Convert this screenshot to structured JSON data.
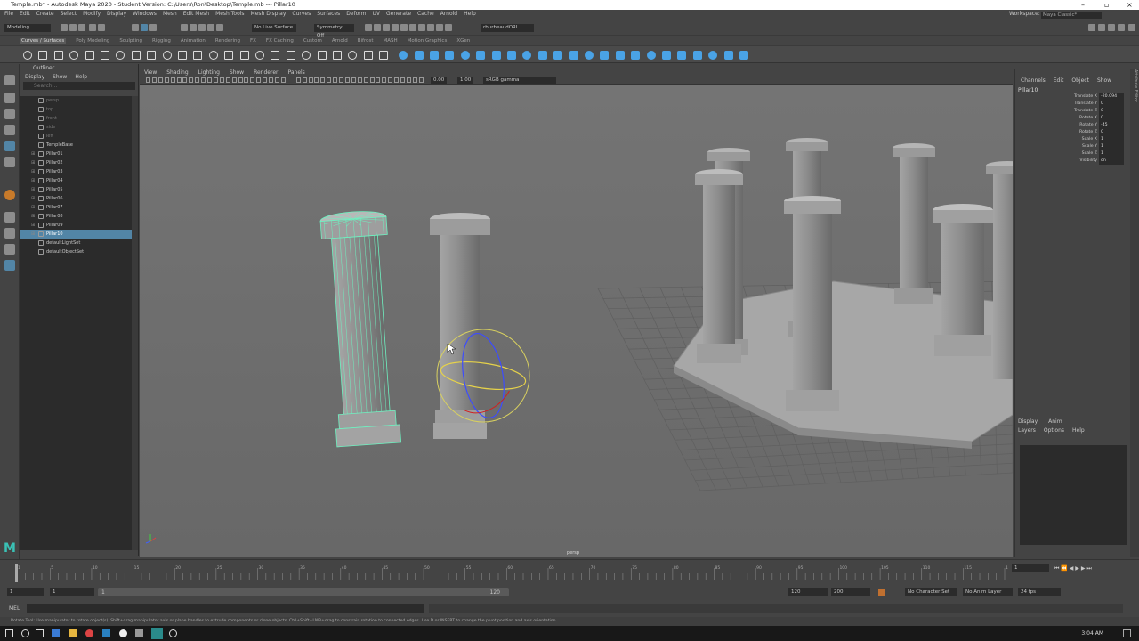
{
  "title_bar": {
    "title": "Temple.mb* - Autodesk Maya 2020 - Student Version: C:\\Users\\Ron\\Desktop\\Temple.mb --- Pillar10"
  },
  "menu_bar": {
    "items": [
      "File",
      "Edit",
      "Create",
      "Select",
      "Modify",
      "Display",
      "Windows",
      "Mesh",
      "Edit Mesh",
      "Mesh Tools",
      "Mesh Display",
      "Curves",
      "Surfaces",
      "Deform",
      "UV",
      "Generate",
      "Cache",
      "Arnold",
      "Help"
    ]
  },
  "workspace": {
    "label": "Workspace:",
    "value": "Maya Classic*"
  },
  "status_line": {
    "mode": "Modeling",
    "live_surface": "No Live Surface",
    "symmetry": "Symmetry: Off",
    "user": "rburbeaudORL"
  },
  "shelf_tabs": [
    "Curves / Surfaces",
    "Poly Modeling",
    "Sculpting",
    "Rigging",
    "Animation",
    "Rendering",
    "FX",
    "FX Caching",
    "Custom",
    "Arnold",
    "Bifrost",
    "MASH",
    "Motion Graphics",
    "XGen"
  ],
  "shelf_tabs_active": 0,
  "outliner": {
    "title": "Outliner",
    "menu": [
      "Display",
      "Show",
      "Help"
    ],
    "search_placeholder": "Search...",
    "items": [
      {
        "label": "persp",
        "dim": true,
        "expandable": false
      },
      {
        "label": "top",
        "dim": true,
        "expandable": false
      },
      {
        "label": "front",
        "dim": true,
        "expandable": false
      },
      {
        "label": "side",
        "dim": true,
        "expandable": false
      },
      {
        "label": "left",
        "dim": true,
        "expandable": false
      },
      {
        "label": "TempleBase",
        "dim": false,
        "expandable": false
      },
      {
        "label": "Pillar01",
        "dim": false,
        "expandable": true
      },
      {
        "label": "Pillar02",
        "dim": false,
        "expandable": true
      },
      {
        "label": "Pillar03",
        "dim": false,
        "expandable": true
      },
      {
        "label": "Pillar04",
        "dim": false,
        "expandable": true
      },
      {
        "label": "Pillar05",
        "dim": false,
        "expandable": true
      },
      {
        "label": "Pillar06",
        "dim": false,
        "expandable": true
      },
      {
        "label": "Pillar07",
        "dim": false,
        "expandable": true
      },
      {
        "label": "Pillar08",
        "dim": false,
        "expandable": true
      },
      {
        "label": "Pillar09",
        "dim": false,
        "expandable": true
      },
      {
        "label": "Pillar10",
        "dim": false,
        "expandable": true,
        "selected": true
      },
      {
        "label": "defaultLightSet",
        "dim": false,
        "expandable": false
      },
      {
        "label": "defaultObjectSet",
        "dim": false,
        "expandable": false
      }
    ]
  },
  "viewport": {
    "menu": [
      "View",
      "Shading",
      "Lighting",
      "Show",
      "Renderer",
      "Panels"
    ],
    "exposure": "0.00",
    "gamma": "1.00",
    "color_space": "sRGB gamma",
    "camera_label": "persp"
  },
  "channel_box": {
    "menu": [
      "Channels",
      "Edit",
      "Object",
      "Show"
    ],
    "object": "Pillar10",
    "channels": [
      {
        "name": "Translate X",
        "value": "-20.094"
      },
      {
        "name": "Translate Y",
        "value": "0"
      },
      {
        "name": "Translate Z",
        "value": "0"
      },
      {
        "name": "Rotate X",
        "value": "0"
      },
      {
        "name": "Rotate Y",
        "value": "-45"
      },
      {
        "name": "Rotate Z",
        "value": "0"
      },
      {
        "name": "Scale X",
        "value": "1"
      },
      {
        "name": "Scale Y",
        "value": "1"
      },
      {
        "name": "Scale Z",
        "value": "1"
      },
      {
        "name": "Visibility",
        "value": "on"
      }
    ],
    "layer_tabs": [
      "Display",
      "Anim"
    ],
    "layer_menu": [
      "Layers",
      "Options",
      "Help"
    ]
  },
  "side_tabs": [
    "Channel Box / Layer Editor",
    "Modeling Toolkit",
    "Attribute Editor"
  ],
  "time_slider": {
    "ticks": [
      "1",
      "",
      "",
      "",
      "5",
      "",
      "",
      "",
      "",
      "10",
      "",
      "",
      "",
      "",
      "15",
      "",
      "",
      "",
      "",
      "20",
      "",
      "",
      "",
      "",
      "25",
      "",
      "",
      "",
      "",
      "30",
      "",
      "",
      "",
      "",
      "35",
      "",
      "",
      "",
      "",
      "40",
      "",
      "",
      "",
      "",
      "45",
      "",
      "",
      "",
      "",
      "50",
      "",
      "",
      "",
      "",
      "55",
      "",
      "",
      "",
      "",
      "60",
      "",
      "",
      "",
      "",
      "65",
      "",
      "",
      "",
      "",
      "70",
      "",
      "",
      "",
      "",
      "75",
      "",
      "",
      "",
      "",
      "80",
      "",
      "",
      "",
      "",
      "85",
      "",
      "",
      "",
      "",
      "90",
      "",
      "",
      "",
      "",
      "95",
      "",
      "",
      "",
      "",
      "100",
      "",
      "",
      "",
      "",
      "105",
      "",
      "",
      "",
      "",
      "110",
      "",
      "",
      "",
      "",
      "115",
      "",
      "",
      "",
      "",
      "120"
    ],
    "current_frame": "1"
  },
  "range_slider": {
    "start": "1",
    "start_inner": "1",
    "end_inner": "120",
    "end": "120",
    "end_outer": "200",
    "character_set": "No Character Set",
    "anim_layer": "No Anim Layer",
    "fps": "24 fps"
  },
  "command_line": {
    "lang": "MEL"
  },
  "help_line": {
    "text": "Rotate Tool: Use manipulator to rotate object(s). Shift+drag manipulator axis or plane handles to extrude components or clone objects. Ctrl+Shift+LMB+drag to constrain rotation to connected edges. Use D or INSERT to change the pivot position and axis orientation."
  },
  "taskbar": {
    "time": "3:04 AM"
  }
}
